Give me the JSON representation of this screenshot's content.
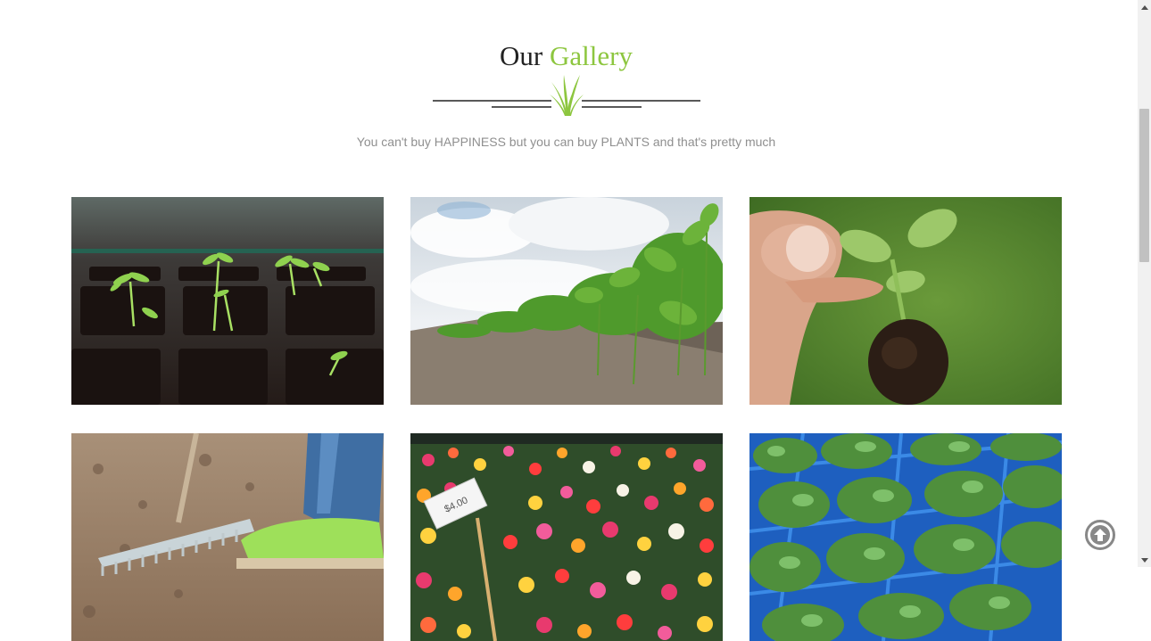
{
  "gallery": {
    "title_prefix": "Our",
    "title_accent": "Gallery",
    "subtitle": "You can't buy HAPPINESS but you can buy PLANTS and that's pretty much",
    "accent_color": "#8dc63f",
    "divider_icon": "grass-icon",
    "images": [
      {
        "name": "seedling-tray-image"
      },
      {
        "name": "soybean-field-image"
      },
      {
        "name": "hand-seedling-image"
      },
      {
        "name": "garden-rake-image"
      },
      {
        "name": "zinnia-flowers-image",
        "price_tag": "$4.00"
      },
      {
        "name": "plant-crates-image"
      }
    ]
  },
  "scroll_top": {
    "icon": "arrow-up-circle-icon"
  },
  "scrollbar": {
    "up_icon": "scroll-up-arrow-icon",
    "down_icon": "scroll-down-arrow-icon"
  }
}
